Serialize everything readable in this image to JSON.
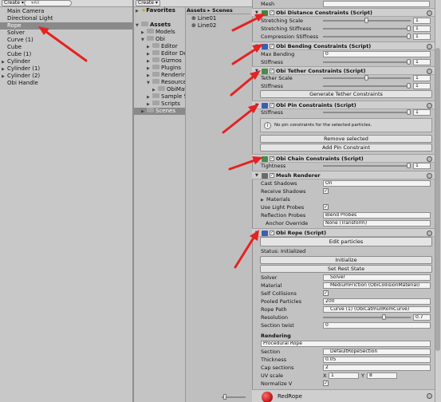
{
  "hierarchy": {
    "create_label": "Create ▾",
    "search_placeholder": "▾All",
    "items": [
      {
        "label": "Main Camera",
        "indent": false,
        "arrow": false,
        "selected": false
      },
      {
        "label": "Directional Light",
        "indent": false,
        "arrow": false,
        "selected": false
      },
      {
        "label": "Rope",
        "indent": false,
        "arrow": false,
        "selected": true
      },
      {
        "label": "Solver",
        "indent": false,
        "arrow": false,
        "selected": false
      },
      {
        "label": "Curve (1)",
        "indent": false,
        "arrow": false,
        "selected": false
      },
      {
        "label": "Cube",
        "indent": false,
        "arrow": false,
        "selected": false
      },
      {
        "label": "Cube (1)",
        "indent": false,
        "arrow": false,
        "selected": false
      },
      {
        "label": "Cylinder",
        "indent": false,
        "arrow": true,
        "selected": false
      },
      {
        "label": "Cylinder (1)",
        "indent": false,
        "arrow": true,
        "selected": false
      },
      {
        "label": "Cylinder (2)",
        "indent": false,
        "arrow": true,
        "selected": false
      },
      {
        "label": "Obi Handle",
        "indent": false,
        "arrow": false,
        "selected": false
      }
    ]
  },
  "project": {
    "create_label": "Create ▾",
    "favorites_label": "Favorites",
    "tree": [
      {
        "label": "Assets",
        "level": 0,
        "open": true,
        "selected": false
      },
      {
        "label": "Models",
        "level": 1,
        "open": false,
        "selected": false
      },
      {
        "label": "Obi",
        "level": 1,
        "open": true,
        "selected": false
      },
      {
        "label": "Editor",
        "level": 2,
        "open": false,
        "selected": false
      },
      {
        "label": "Editor De",
        "level": 2,
        "open": false,
        "selected": false
      },
      {
        "label": "Gizmos",
        "level": 2,
        "open": false,
        "selected": false
      },
      {
        "label": "Plugins",
        "level": 2,
        "open": false,
        "selected": false
      },
      {
        "label": "Rendering",
        "level": 2,
        "open": false,
        "selected": false
      },
      {
        "label": "Resource",
        "level": 2,
        "open": true,
        "selected": false
      },
      {
        "label": "ObiMat",
        "level": 3,
        "open": false,
        "selected": false
      },
      {
        "label": "Sample S",
        "level": 2,
        "open": false,
        "selected": false
      },
      {
        "label": "Scripts",
        "level": 2,
        "open": false,
        "selected": false
      },
      {
        "label": "Scenes",
        "level": 1,
        "open": false,
        "selected": true
      }
    ],
    "breadcrumb": "Assets ▸ Scenes",
    "files": [
      "Line01",
      "Line02"
    ]
  },
  "inspector": {
    "mesh_label": "Mesh",
    "distance": {
      "title": "Obi Distance Constraints (Script)",
      "rows": [
        {
          "label": "Stretching Scale",
          "value": "1",
          "knob": 0.5
        },
        {
          "label": "Stretching Stiffness",
          "value": "1",
          "knob": 1.0
        },
        {
          "label": "Compression Stiffness",
          "value": "1",
          "knob": 1.0
        }
      ]
    },
    "bending": {
      "title": "Obi Bending Constraints (Script)",
      "max_bending_label": "Max Bending",
      "max_bending_value": "0",
      "stiffness_label": "Stiffness",
      "stiffness_value": "1"
    },
    "tether": {
      "title": "Obi Tether Constraints (Script)",
      "scale_label": "Tether Scale",
      "scale_value": "1",
      "stiffness_label": "Stiffness",
      "stiffness_value": "1",
      "generate_button": "Generate Tether Constraints"
    },
    "pin": {
      "title": "Obi Pin Constraints (Script)",
      "stiffness_label": "Stiffness",
      "stiffness_value": "1",
      "info_text": "No pin constraints for the selected particles.",
      "remove_button": "Remove selected",
      "add_button": "Add Pin Constraint"
    },
    "chain": {
      "title": "Obi Chain Constraints (Script)",
      "tightness_label": "Tightness",
      "tightness_value": "1"
    },
    "mesh_renderer": {
      "title": "Mesh Renderer",
      "cast_shadows_label": "Cast Shadows",
      "cast_shadows_value": "On",
      "receive_shadows_label": "Receive Shadows",
      "materials_label": "Materials",
      "light_probes_label": "Use Light Probes",
      "reflection_label": "Reflection Probes",
      "reflection_value": "Blend Probes",
      "anchor_label": "Anchor Override",
      "anchor_value": "None (Transform)"
    },
    "rope": {
      "title": "Obi Rope (Script)",
      "edit_button": "Edit particles",
      "status": "Status: Initialized",
      "initialize_button": "Initialize",
      "reset_button": "Set Rest State",
      "solver_label": "Solver",
      "solver_value": "Solver",
      "material_label": "Material",
      "material_value": "MediumFriction (ObiCollisionMaterial)",
      "self_collisions_label": "Self Collisions",
      "pooled_label": "Pooled Particles",
      "pooled_value": "200",
      "path_label": "Rope Path",
      "path_value": "Curve (1) (ObiCatmullRomCurve)",
      "resolution_label": "Resolution",
      "resolution_value": "0.7",
      "twist_label": "Section twist",
      "twist_value": "0",
      "rendering_label": "Rendering",
      "rendering_value": "Procedural Rope",
      "section_label": "Section",
      "section_value": "DefaultRopeSection",
      "thickness_label": "Thickness",
      "thickness_value": "0.05",
      "cap_label": "Cap sections",
      "cap_value": "2",
      "uv_label": "UV scale",
      "uv_x_label": "X",
      "uv_x": "1",
      "uv_y_label": "Y",
      "uv_y": "8",
      "normalize_label": "Normalize V"
    },
    "material_preview": "RedRope"
  },
  "colors": {
    "annotation_arrow": "#e52222",
    "panel_bg": "#c2c2c2",
    "selection": "#8a8a8a",
    "material_ball": "#c41f1f"
  }
}
